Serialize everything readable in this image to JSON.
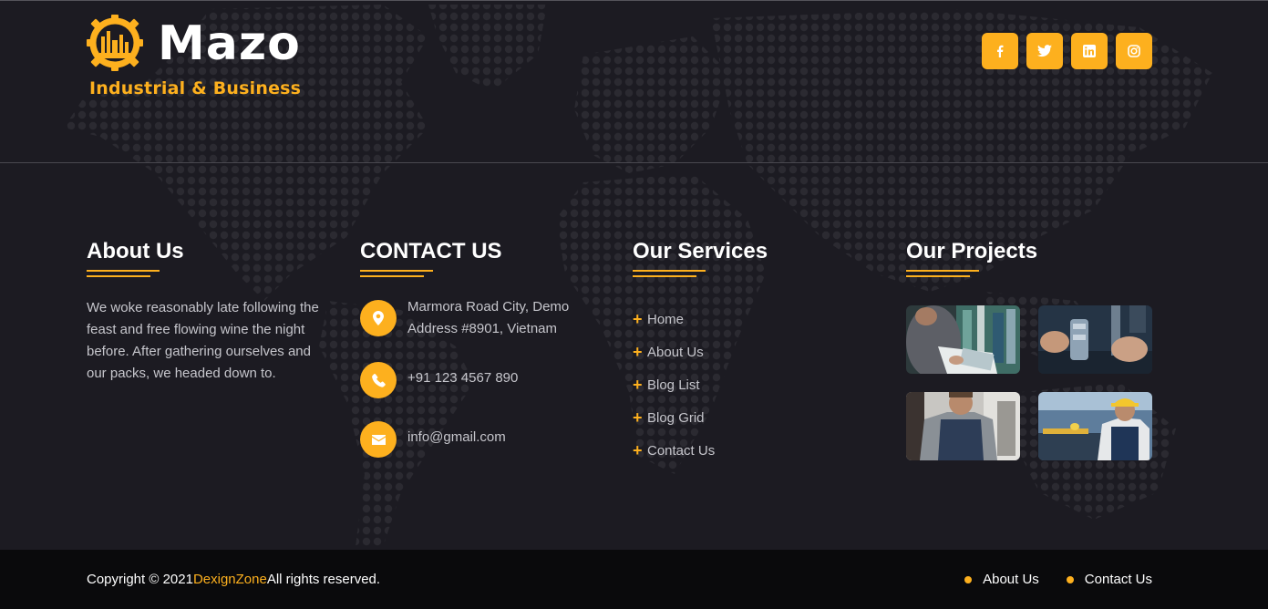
{
  "brand": {
    "name": "Mazo",
    "tagline": "Industrial & Business"
  },
  "social": [
    {
      "icon": "facebook-icon"
    },
    {
      "icon": "twitter-icon"
    },
    {
      "icon": "linkedin-icon"
    },
    {
      "icon": "instagram-icon"
    }
  ],
  "about": {
    "title": "About Us",
    "text": "We woke reasonably late following the feast and free flowing wine the night before. After gathering ourselves and our packs, we headed down to."
  },
  "contact": {
    "title": "CONTACT US",
    "address": "Marmora Road City, Demo Address #8901, Vietnam",
    "phone": "+91 123 4567 890",
    "email": "info@gmail.com"
  },
  "services": {
    "title": "Our Services",
    "items": [
      "Home",
      "About Us",
      "Blog List",
      "Blog Grid",
      "Contact Us"
    ]
  },
  "projects": {
    "title": "Our Projects"
  },
  "footer": {
    "copyright_prefix": "Copyright © 2021",
    "copyright_brand": "DexignZone",
    "copyright_suffix": "All rights reserved.",
    "links": [
      "About Us",
      "Contact Us"
    ]
  },
  "colors": {
    "accent": "#fdb01e",
    "background": "#1c1b22",
    "bottom_bar": "#0a0a0c"
  }
}
